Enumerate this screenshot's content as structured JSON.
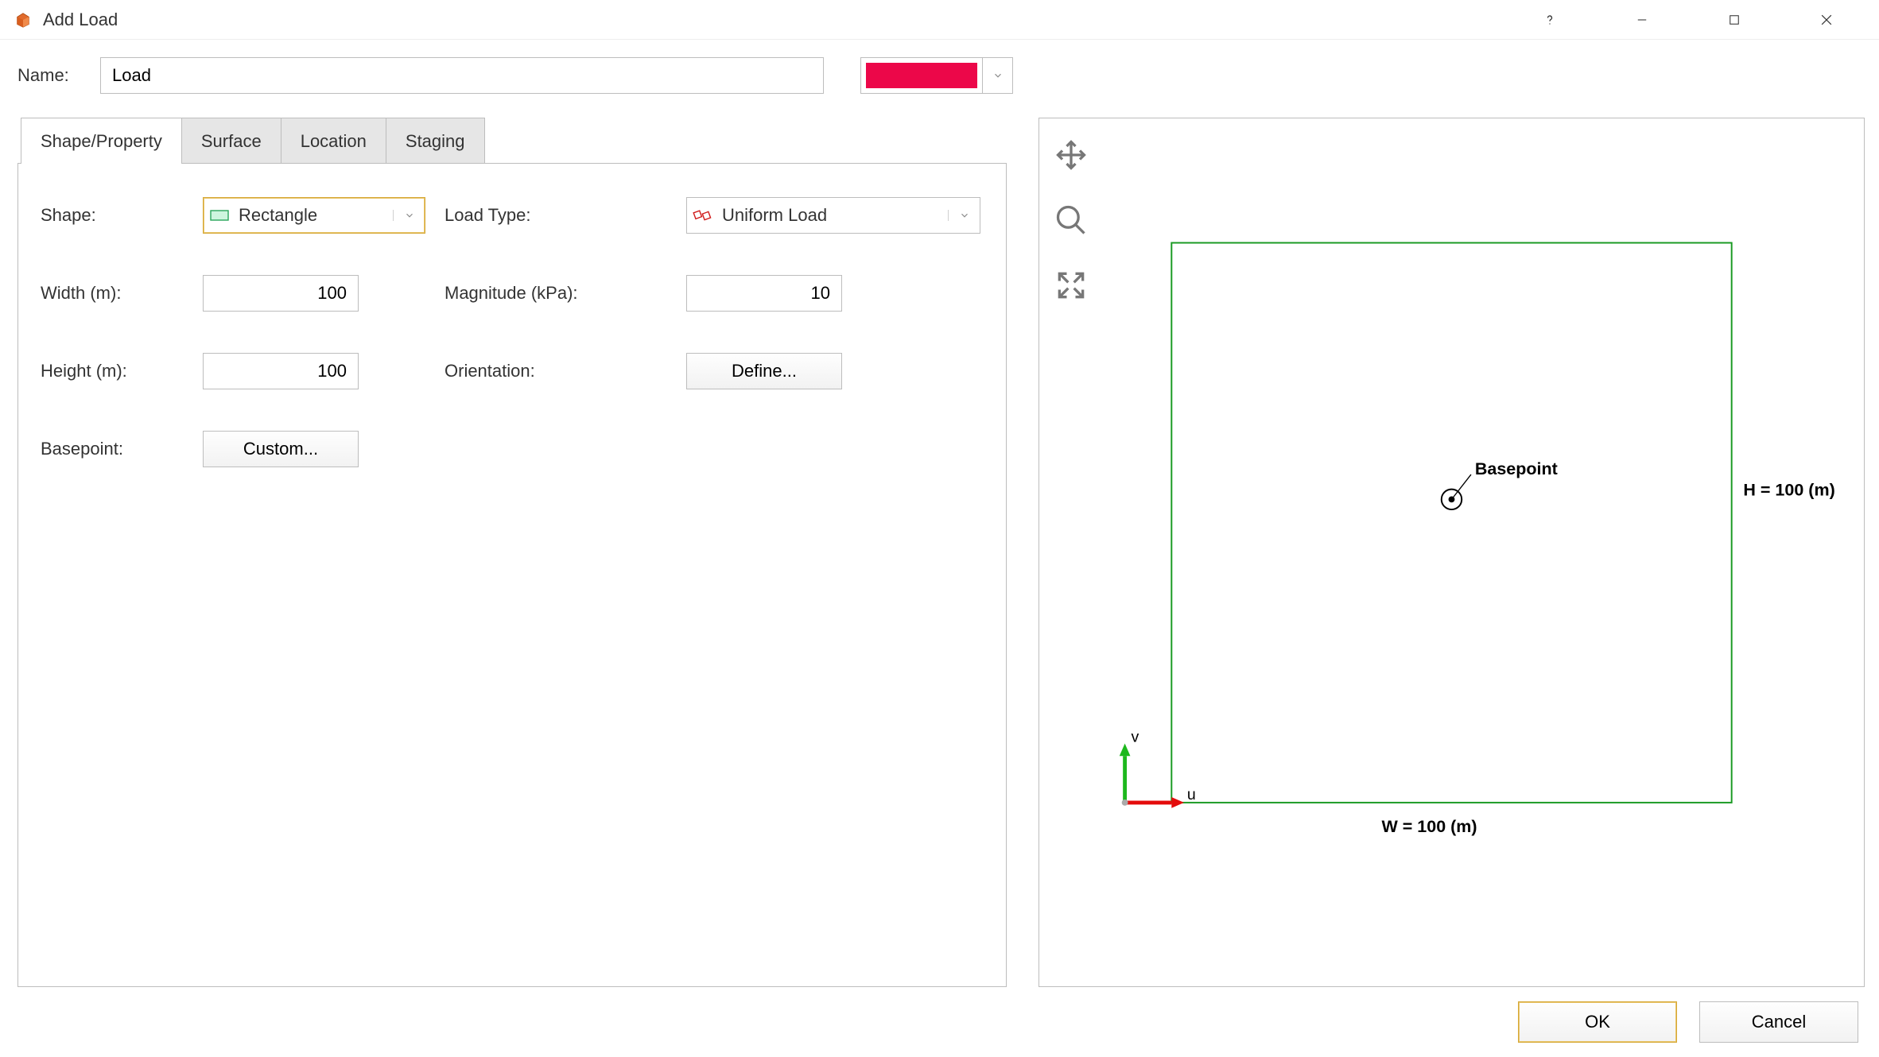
{
  "window": {
    "title": "Add Load"
  },
  "name_row": {
    "label": "Name:",
    "value": "Load",
    "color": "#ec0749"
  },
  "tabs": [
    {
      "label": "Shape/Property",
      "active": true
    },
    {
      "label": "Surface",
      "active": false
    },
    {
      "label": "Location",
      "active": false
    },
    {
      "label": "Staging",
      "active": false
    }
  ],
  "form": {
    "shape_label": "Shape:",
    "shape_value": "Rectangle",
    "load_type_label": "Load Type:",
    "load_type_value": "Uniform Load",
    "width_label": "Width (m):",
    "width_value": "100",
    "magnitude_label": "Magnitude (kPa):",
    "magnitude_value": "10",
    "height_label": "Height (m):",
    "height_value": "100",
    "orientation_label": "Orientation:",
    "orientation_button": "Define...",
    "basepoint_label": "Basepoint:",
    "basepoint_button": "Custom..."
  },
  "preview": {
    "basepoint_label": "Basepoint",
    "h_label": "H = 100 (m)",
    "w_label": "W = 100 (m)",
    "u_label": "u",
    "v_label": "v"
  },
  "footer": {
    "ok": "OK",
    "cancel": "Cancel"
  }
}
